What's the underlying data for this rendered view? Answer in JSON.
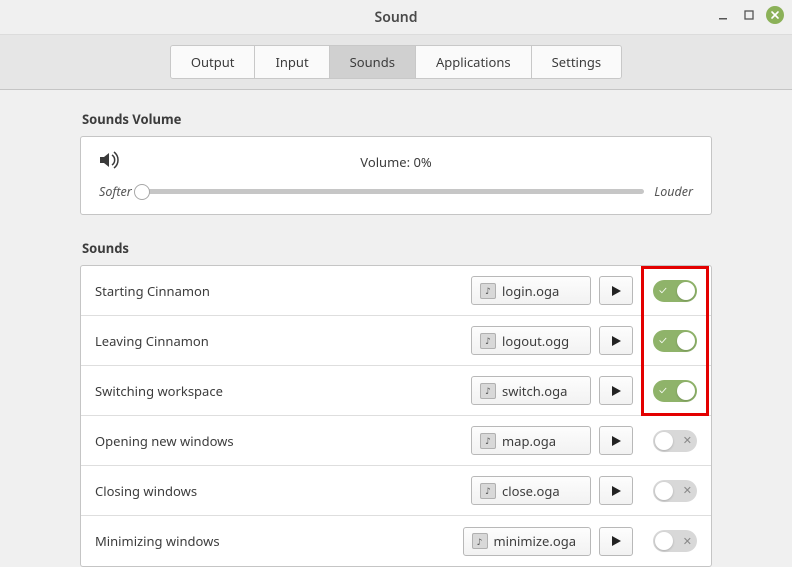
{
  "window": {
    "title": "Sound"
  },
  "tabs": [
    {
      "label": "Output",
      "active": false
    },
    {
      "label": "Input",
      "active": false
    },
    {
      "label": "Sounds",
      "active": true
    },
    {
      "label": "Applications",
      "active": false
    },
    {
      "label": "Settings",
      "active": false
    }
  ],
  "volume": {
    "section_label": "Sounds Volume",
    "label": "Volume: 0%",
    "value_percent": 0,
    "softer": "Softer",
    "louder": "Louder"
  },
  "sounds": {
    "section_label": "Sounds",
    "items": [
      {
        "label": "Starting Cinnamon",
        "file": "login.oga",
        "enabled": true
      },
      {
        "label": "Leaving Cinnamon",
        "file": "logout.ogg",
        "enabled": true
      },
      {
        "label": "Switching workspace",
        "file": "switch.oga",
        "enabled": true
      },
      {
        "label": "Opening new windows",
        "file": "map.oga",
        "enabled": false
      },
      {
        "label": "Closing windows",
        "file": "close.oga",
        "enabled": false
      },
      {
        "label": "Minimizing windows",
        "file": "minimize.oga",
        "enabled": false
      }
    ]
  },
  "highlight": {
    "first_row_index": 0,
    "last_row_index": 2
  }
}
